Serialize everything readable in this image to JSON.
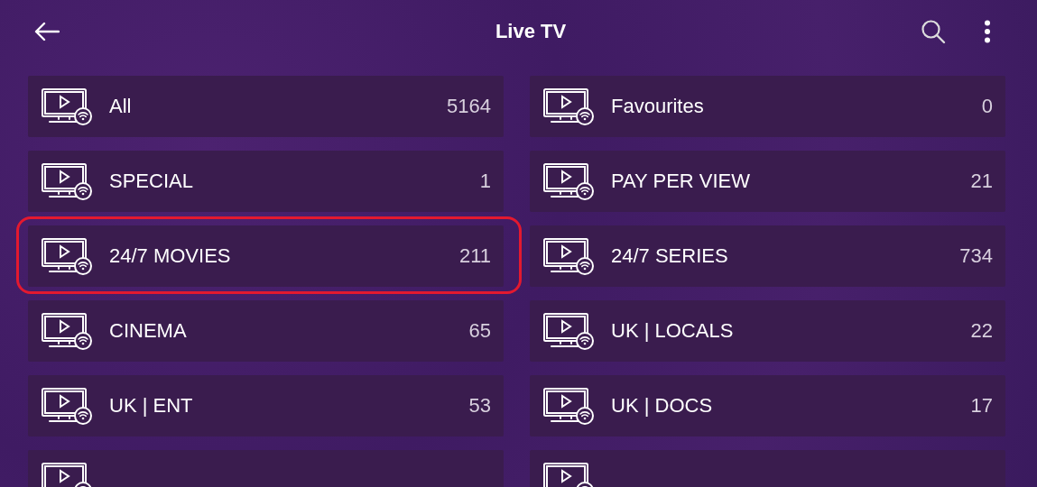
{
  "header": {
    "title": "Live TV"
  },
  "categories": [
    {
      "label": "All",
      "count": "5164",
      "highlighted": false
    },
    {
      "label": "Favourites",
      "count": "0",
      "highlighted": false
    },
    {
      "label": "SPECIAL",
      "count": "1",
      "highlighted": false
    },
    {
      "label": "PAY PER VIEW",
      "count": "21",
      "highlighted": false
    },
    {
      "label": "24/7 MOVIES",
      "count": "211",
      "highlighted": true
    },
    {
      "label": "24/7 SERIES",
      "count": "734",
      "highlighted": false
    },
    {
      "label": "CINEMA",
      "count": "65",
      "highlighted": false
    },
    {
      "label": "UK | LOCALS",
      "count": "22",
      "highlighted": false
    },
    {
      "label": "UK | ENT",
      "count": "53",
      "highlighted": false
    },
    {
      "label": "UK | DOCS",
      "count": "17",
      "highlighted": false
    },
    {
      "highlighted": false
    },
    {
      "highlighted": false
    }
  ]
}
